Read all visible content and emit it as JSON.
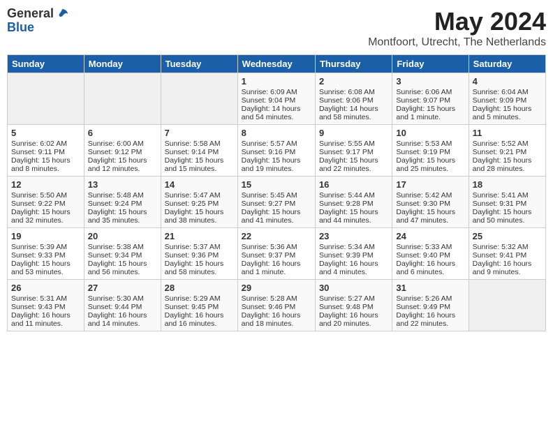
{
  "logo": {
    "general": "General",
    "blue": "Blue"
  },
  "header": {
    "month": "May 2024",
    "location": "Montfoort, Utrecht, The Netherlands"
  },
  "weekdays": [
    "Sunday",
    "Monday",
    "Tuesday",
    "Wednesday",
    "Thursday",
    "Friday",
    "Saturday"
  ],
  "weeks": [
    [
      {
        "day": "",
        "info": ""
      },
      {
        "day": "",
        "info": ""
      },
      {
        "day": "",
        "info": ""
      },
      {
        "day": "1",
        "info": "Sunrise: 6:09 AM\nSunset: 9:04 PM\nDaylight: 14 hours and 54 minutes."
      },
      {
        "day": "2",
        "info": "Sunrise: 6:08 AM\nSunset: 9:06 PM\nDaylight: 14 hours and 58 minutes."
      },
      {
        "day": "3",
        "info": "Sunrise: 6:06 AM\nSunset: 9:07 PM\nDaylight: 15 hours and 1 minute."
      },
      {
        "day": "4",
        "info": "Sunrise: 6:04 AM\nSunset: 9:09 PM\nDaylight: 15 hours and 5 minutes."
      }
    ],
    [
      {
        "day": "5",
        "info": "Sunrise: 6:02 AM\nSunset: 9:11 PM\nDaylight: 15 hours and 8 minutes."
      },
      {
        "day": "6",
        "info": "Sunrise: 6:00 AM\nSunset: 9:12 PM\nDaylight: 15 hours and 12 minutes."
      },
      {
        "day": "7",
        "info": "Sunrise: 5:58 AM\nSunset: 9:14 PM\nDaylight: 15 hours and 15 minutes."
      },
      {
        "day": "8",
        "info": "Sunrise: 5:57 AM\nSunset: 9:16 PM\nDaylight: 15 hours and 19 minutes."
      },
      {
        "day": "9",
        "info": "Sunrise: 5:55 AM\nSunset: 9:17 PM\nDaylight: 15 hours and 22 minutes."
      },
      {
        "day": "10",
        "info": "Sunrise: 5:53 AM\nSunset: 9:19 PM\nDaylight: 15 hours and 25 minutes."
      },
      {
        "day": "11",
        "info": "Sunrise: 5:52 AM\nSunset: 9:21 PM\nDaylight: 15 hours and 28 minutes."
      }
    ],
    [
      {
        "day": "12",
        "info": "Sunrise: 5:50 AM\nSunset: 9:22 PM\nDaylight: 15 hours and 32 minutes."
      },
      {
        "day": "13",
        "info": "Sunrise: 5:48 AM\nSunset: 9:24 PM\nDaylight: 15 hours and 35 minutes."
      },
      {
        "day": "14",
        "info": "Sunrise: 5:47 AM\nSunset: 9:25 PM\nDaylight: 15 hours and 38 minutes."
      },
      {
        "day": "15",
        "info": "Sunrise: 5:45 AM\nSunset: 9:27 PM\nDaylight: 15 hours and 41 minutes."
      },
      {
        "day": "16",
        "info": "Sunrise: 5:44 AM\nSunset: 9:28 PM\nDaylight: 15 hours and 44 minutes."
      },
      {
        "day": "17",
        "info": "Sunrise: 5:42 AM\nSunset: 9:30 PM\nDaylight: 15 hours and 47 minutes."
      },
      {
        "day": "18",
        "info": "Sunrise: 5:41 AM\nSunset: 9:31 PM\nDaylight: 15 hours and 50 minutes."
      }
    ],
    [
      {
        "day": "19",
        "info": "Sunrise: 5:39 AM\nSunset: 9:33 PM\nDaylight: 15 hours and 53 minutes."
      },
      {
        "day": "20",
        "info": "Sunrise: 5:38 AM\nSunset: 9:34 PM\nDaylight: 15 hours and 56 minutes."
      },
      {
        "day": "21",
        "info": "Sunrise: 5:37 AM\nSunset: 9:36 PM\nDaylight: 15 hours and 58 minutes."
      },
      {
        "day": "22",
        "info": "Sunrise: 5:36 AM\nSunset: 9:37 PM\nDaylight: 16 hours and 1 minute."
      },
      {
        "day": "23",
        "info": "Sunrise: 5:34 AM\nSunset: 9:39 PM\nDaylight: 16 hours and 4 minutes."
      },
      {
        "day": "24",
        "info": "Sunrise: 5:33 AM\nSunset: 9:40 PM\nDaylight: 16 hours and 6 minutes."
      },
      {
        "day": "25",
        "info": "Sunrise: 5:32 AM\nSunset: 9:41 PM\nDaylight: 16 hours and 9 minutes."
      }
    ],
    [
      {
        "day": "26",
        "info": "Sunrise: 5:31 AM\nSunset: 9:43 PM\nDaylight: 16 hours and 11 minutes."
      },
      {
        "day": "27",
        "info": "Sunrise: 5:30 AM\nSunset: 9:44 PM\nDaylight: 16 hours and 14 minutes."
      },
      {
        "day": "28",
        "info": "Sunrise: 5:29 AM\nSunset: 9:45 PM\nDaylight: 16 hours and 16 minutes."
      },
      {
        "day": "29",
        "info": "Sunrise: 5:28 AM\nSunset: 9:46 PM\nDaylight: 16 hours and 18 minutes."
      },
      {
        "day": "30",
        "info": "Sunrise: 5:27 AM\nSunset: 9:48 PM\nDaylight: 16 hours and 20 minutes."
      },
      {
        "day": "31",
        "info": "Sunrise: 5:26 AM\nSunset: 9:49 PM\nDaylight: 16 hours and 22 minutes."
      },
      {
        "day": "",
        "info": ""
      }
    ]
  ]
}
